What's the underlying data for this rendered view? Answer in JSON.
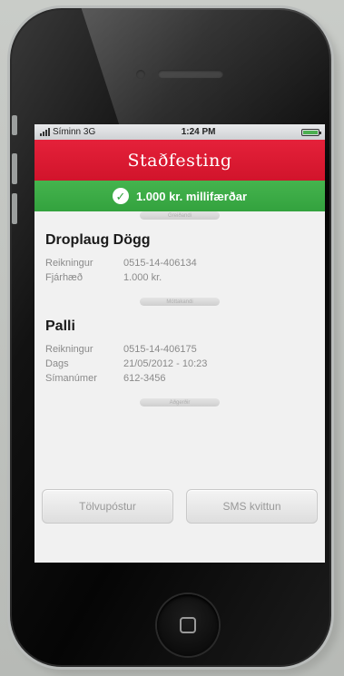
{
  "status_bar": {
    "carrier": "Síminn 3G",
    "time": "1:24 PM"
  },
  "header": {
    "title": "Staðfesting"
  },
  "success": {
    "message": "1.000 kr. millifærðar"
  },
  "dividers": {
    "first": "Greiðandi",
    "second": "Móttakandi",
    "third": "Aðgerðir"
  },
  "payer": {
    "name": "Droplaug Dögg",
    "rows": [
      {
        "label": "Reikningur",
        "value": "0515-14-406134"
      },
      {
        "label": "Fjárhæð",
        "value": "1.000 kr."
      }
    ]
  },
  "recipient": {
    "name": "Palli",
    "rows": [
      {
        "label": "Reikningur",
        "value": "0515-14-406175"
      },
      {
        "label": "Dags",
        "value": "21/05/2012 - 10:23"
      },
      {
        "label": "Símanúmer",
        "value": "612-3456"
      }
    ]
  },
  "actions": {
    "email_label": "Tölvupóstur",
    "sms_label": "SMS kvittun"
  },
  "colors": {
    "header_red": "#d1142b",
    "success_green": "#33a23e"
  }
}
